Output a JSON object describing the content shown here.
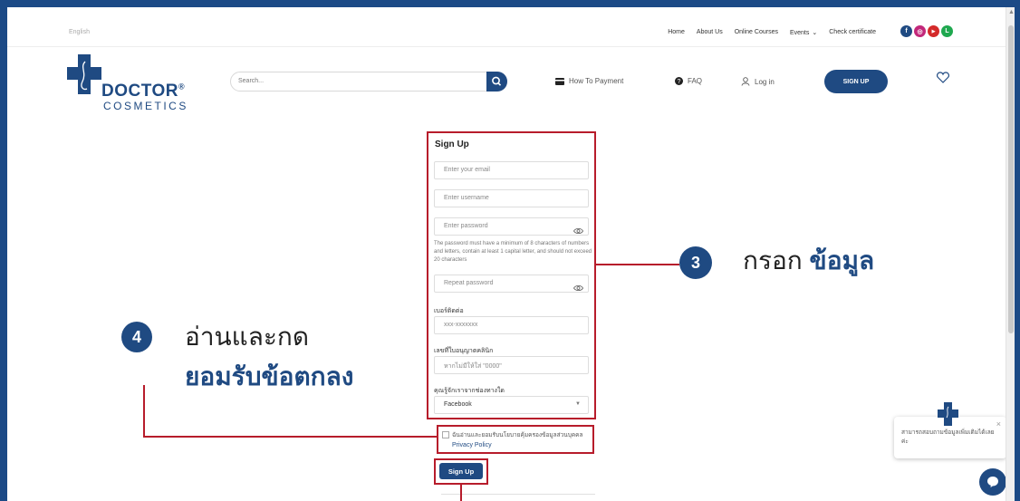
{
  "topbar": {
    "language": "English",
    "nav": [
      "Home",
      "About Us",
      "Online Courses",
      "Events",
      "Check certificate"
    ],
    "socials": [
      {
        "icon": "facebook-icon",
        "glyph": "f",
        "color": "#1f4a82"
      },
      {
        "icon": "instagram-icon",
        "glyph": "◎",
        "color": "#c2287a"
      },
      {
        "icon": "youtube-icon",
        "glyph": "▶",
        "color": "#d42a2a"
      },
      {
        "icon": "line-icon",
        "glyph": "L",
        "color": "#1fa84f"
      }
    ]
  },
  "header": {
    "logo_main": "DOCTOR",
    "logo_reg": "®",
    "logo_sub": "COSMETICS",
    "search_placeholder": "Search...",
    "how_to_payment": "How To Payment",
    "faq": "FAQ",
    "login": "Log in",
    "signup": "SIGN UP"
  },
  "form": {
    "title": "Sign Up",
    "email_placeholder": "Enter your email",
    "username_placeholder": "Enter username",
    "password_placeholder": "Enter password",
    "password_hint": "The password must have a minimum of 8 characters of numbers and letters, contain at least 1 capital letter, and should not exceed 20 characters",
    "repeat_placeholder": "Repeat password",
    "phone_label": "เบอร์ติดต่อ",
    "phone_placeholder": "xxx-xxxxxxx",
    "license_label": "เลขที่ใบอนุญาตคลินิก",
    "license_placeholder": "หากไม่มีให้ใส่ \"0000\"",
    "source_label": "คุณรู้จักเราจากช่องทางใด",
    "source_value": "Facebook",
    "consent_text": "ฉันอ่านและยอมรับนโยบายคุ้มครองข้อมูลส่วนบุคคล",
    "privacy_link": "Privacy Policy",
    "submit": "Sign Up"
  },
  "annotations": {
    "step3_num": "3",
    "step3_text": "กรอก",
    "step3_bold": "ข้อมูล",
    "step4_num": "4",
    "step4_line1": "อ่านและกด",
    "step4_line2": "ยอมรับข้อตกลง"
  },
  "chat": {
    "message": "สามารถสอบถามข้อมูลเพิ่มเติมได้เลยค่ะ",
    "close": "×"
  },
  "colors": {
    "brand": "#1f4a82",
    "annotation_red": "#b71c2b"
  }
}
